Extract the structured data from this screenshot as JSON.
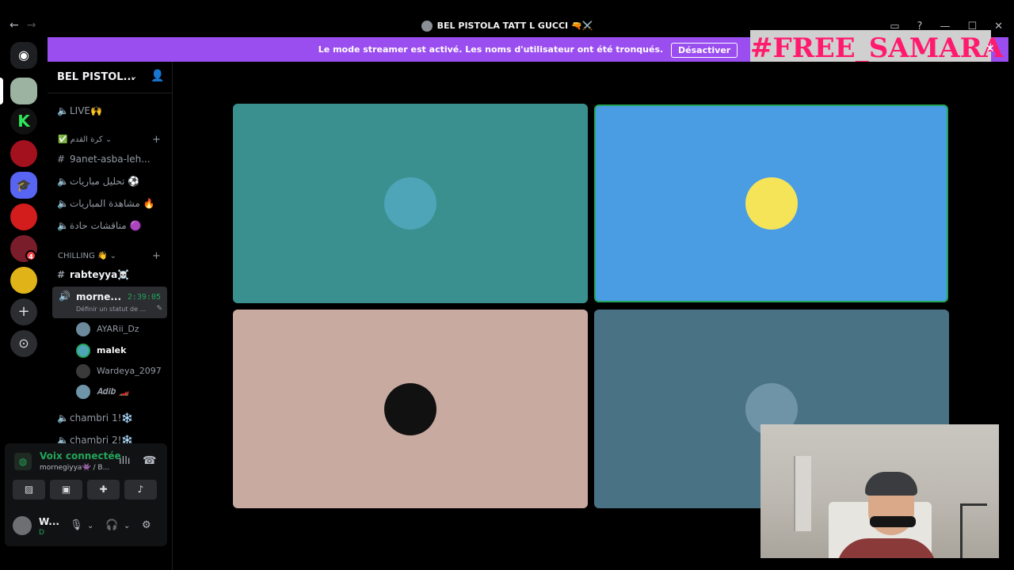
{
  "window": {
    "title": "BEL PISTOLA TATT L GUCCI 🔫⚔️",
    "back": "←",
    "forward": "→",
    "controls": [
      "▭",
      "?",
      "—",
      "☐",
      "✕"
    ]
  },
  "banner": {
    "text": "Le mode streamer est activé. Les noms d'utilisateur ont été tronqués.",
    "button_label": "Désactiver",
    "color": "#9b4ef0"
  },
  "overlay": {
    "text": "#FREE_SAMARA",
    "close": "✕"
  },
  "guild_bar": {
    "home_icon": "discord-icon",
    "badge": "4",
    "add_label": "+",
    "discover_label": "⊙"
  },
  "sidebar": {
    "server_name": "BEL PISTOL...",
    "channels": {
      "live": "LIVE🙌",
      "cat1": "✅ كرة القدم ⌄",
      "ch1": "9anet-asba-leh...",
      "ch2": "تحليل مباريات ⚽",
      "ch3": "مشاهدة المباريات 🔥",
      "ch4": "مناقشات حادة 🟣",
      "cat2": "CHILLING 👋 ⌄",
      "ch5": "rabteyya☠️",
      "ch6": "chambri 1!❄️",
      "ch7": "chambri 2!❄️"
    },
    "active_channel": {
      "name": "morne...",
      "time": "2:39:05",
      "status": "Définir un statut de ..."
    },
    "voice_users": [
      "AYARii_Dz",
      "malek",
      "Wardeya_2097",
      "𝑨𝒅𝒊𝒃 🏎️"
    ]
  },
  "voice_panel": {
    "connected": "Voix connectée",
    "channel": "mornegiyya👾 / B..."
  },
  "user": {
    "name": "W...",
    "status": "D"
  },
  "tiles": [
    {
      "color": "#3a8f8f",
      "avatar_color": "#4fa5b8"
    },
    {
      "color": "#4a9de3",
      "avatar_color": "#f6e458"
    },
    {
      "color": "#c8aaa0",
      "avatar_color": "#111111"
    },
    {
      "color": "#4a7285",
      "avatar_color": "#6f94a8"
    }
  ]
}
